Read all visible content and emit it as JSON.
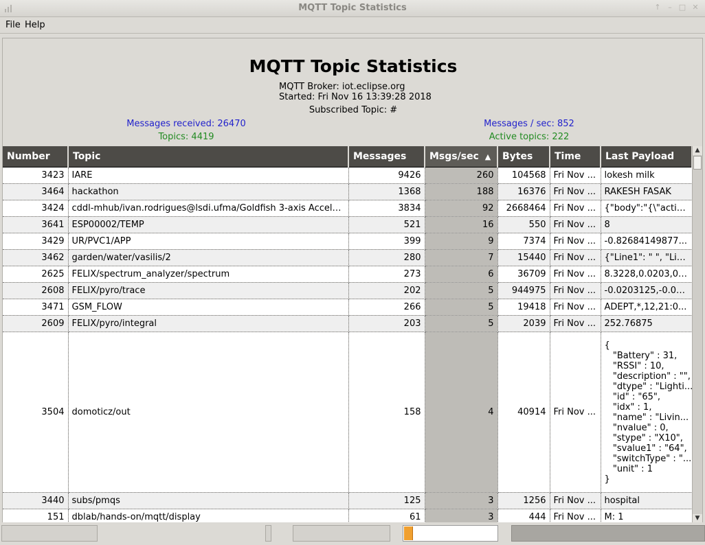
{
  "window": {
    "title": "MQTT Topic Statistics"
  },
  "menu": {
    "file": "File",
    "help": "Help"
  },
  "header": {
    "title": "MQTT Topic Statistics",
    "broker": "MQTT Broker: iot.eclipse.org",
    "started": "Started: Fri Nov 16 13:39:28 2018",
    "subscribed": "Subscribed Topic: #"
  },
  "stats": {
    "messages_received": "Messages received: 26470",
    "topics": "Topics: 4419",
    "msgs_per_sec": "Messages / sec: 852",
    "active_topics": "Active topics: 222"
  },
  "colors": {
    "stat_blue": "#2222cc",
    "stat_green": "#228b22",
    "header_bg": "#4d4b47",
    "sorted_col_bg": "#bebcb7",
    "progress_fill": "#f0a030"
  },
  "table": {
    "columns": [
      "Number",
      "Topic",
      "Messages",
      "Msgs/sec",
      "Bytes",
      "Time",
      "Last Payload"
    ],
    "sort_indicator": "▲",
    "rows": [
      {
        "number": "3423",
        "topic": "IARE",
        "messages": "9426",
        "msgs_sec": "260",
        "bytes": "104568",
        "time": "Fri Nov ...",
        "payload": "lokesh milk"
      },
      {
        "number": "3464",
        "topic": "hackathon",
        "messages": "1368",
        "msgs_sec": "188",
        "bytes": "16376",
        "time": "Fri Nov ...",
        "payload": "RAKESH FASAK"
      },
      {
        "number": "3424",
        "topic": "cddl-mhub/ivan.rodrigues@lsdi.ufma/Goldfish 3-axis Acceler...",
        "messages": "3834",
        "msgs_sec": "92",
        "bytes": "2668464",
        "time": "Fri Nov ...",
        "payload": "{\"body\":\"{\\\"actio..."
      },
      {
        "number": "3641",
        "topic": "ESP00002/TEMP",
        "messages": "521",
        "msgs_sec": "16",
        "bytes": "550",
        "time": "Fri Nov ...",
        "payload": "8"
      },
      {
        "number": "3429",
        "topic": "UR/PVC1/APP",
        "messages": "399",
        "msgs_sec": "9",
        "bytes": "7374",
        "time": "Fri Nov ...",
        "payload": "-0.82684149877..."
      },
      {
        "number": "3462",
        "topic": "garden/water/vasilis/2",
        "messages": "280",
        "msgs_sec": "7",
        "bytes": "15440",
        "time": "Fri Nov ...",
        "payload": "{\"Line1\": \" \", \"Lin..."
      },
      {
        "number": "2625",
        "topic": "FELIX/spectrum_analyzer/spectrum",
        "messages": "273",
        "msgs_sec": "6",
        "bytes": "36709",
        "time": "Fri Nov ...",
        "payload": "8.3228,0.0203,0...."
      },
      {
        "number": "2608",
        "topic": "FELIX/pyro/trace",
        "messages": "202",
        "msgs_sec": "5",
        "bytes": "944975",
        "time": "Fri Nov ...",
        "payload": "-0.0203125,-0.02..."
      },
      {
        "number": "3471",
        "topic": "GSM_FLOW",
        "messages": "266",
        "msgs_sec": "5",
        "bytes": "19418",
        "time": "Fri Nov ...",
        "payload": "ADEPT,*,12,21:0..."
      },
      {
        "number": "2609",
        "topic": "FELIX/pyro/integral",
        "messages": "203",
        "msgs_sec": "5",
        "bytes": "2039",
        "time": "Fri Nov ...",
        "payload": "252.76875"
      },
      {
        "number": "3504",
        "topic": "domoticz/out",
        "messages": "158",
        "msgs_sec": "4",
        "bytes": "40914",
        "time": "Fri Nov ...",
        "payload": "{\n   \"Battery\" : 31,\n   \"RSSI\" : 10,\n   \"description\" : \"\",\n   \"dtype\" : \"Lighti...\n   \"id\" : \"65\",\n   \"idx\" : 1,\n   \"name\" : \"Livin...\n   \"nvalue\" : 0,\n   \"stype\" : \"X10\",\n   \"svalue1\" : \"64\",\n   \"switchType\" : \"...\n   \"unit\" : 1\n}"
      },
      {
        "number": "3440",
        "topic": "subs/pmqs",
        "messages": "125",
        "msgs_sec": "3",
        "bytes": "1256",
        "time": "Fri Nov ...",
        "payload": " hospital"
      },
      {
        "number": "151",
        "topic": "dblab/hands-on/mqtt/display",
        "messages": "61",
        "msgs_sec": "3",
        "bytes": "444",
        "time": "Fri Nov ...",
        "payload": "M: 1"
      }
    ]
  },
  "statusbar": {
    "progress_fraction": 0.09
  }
}
